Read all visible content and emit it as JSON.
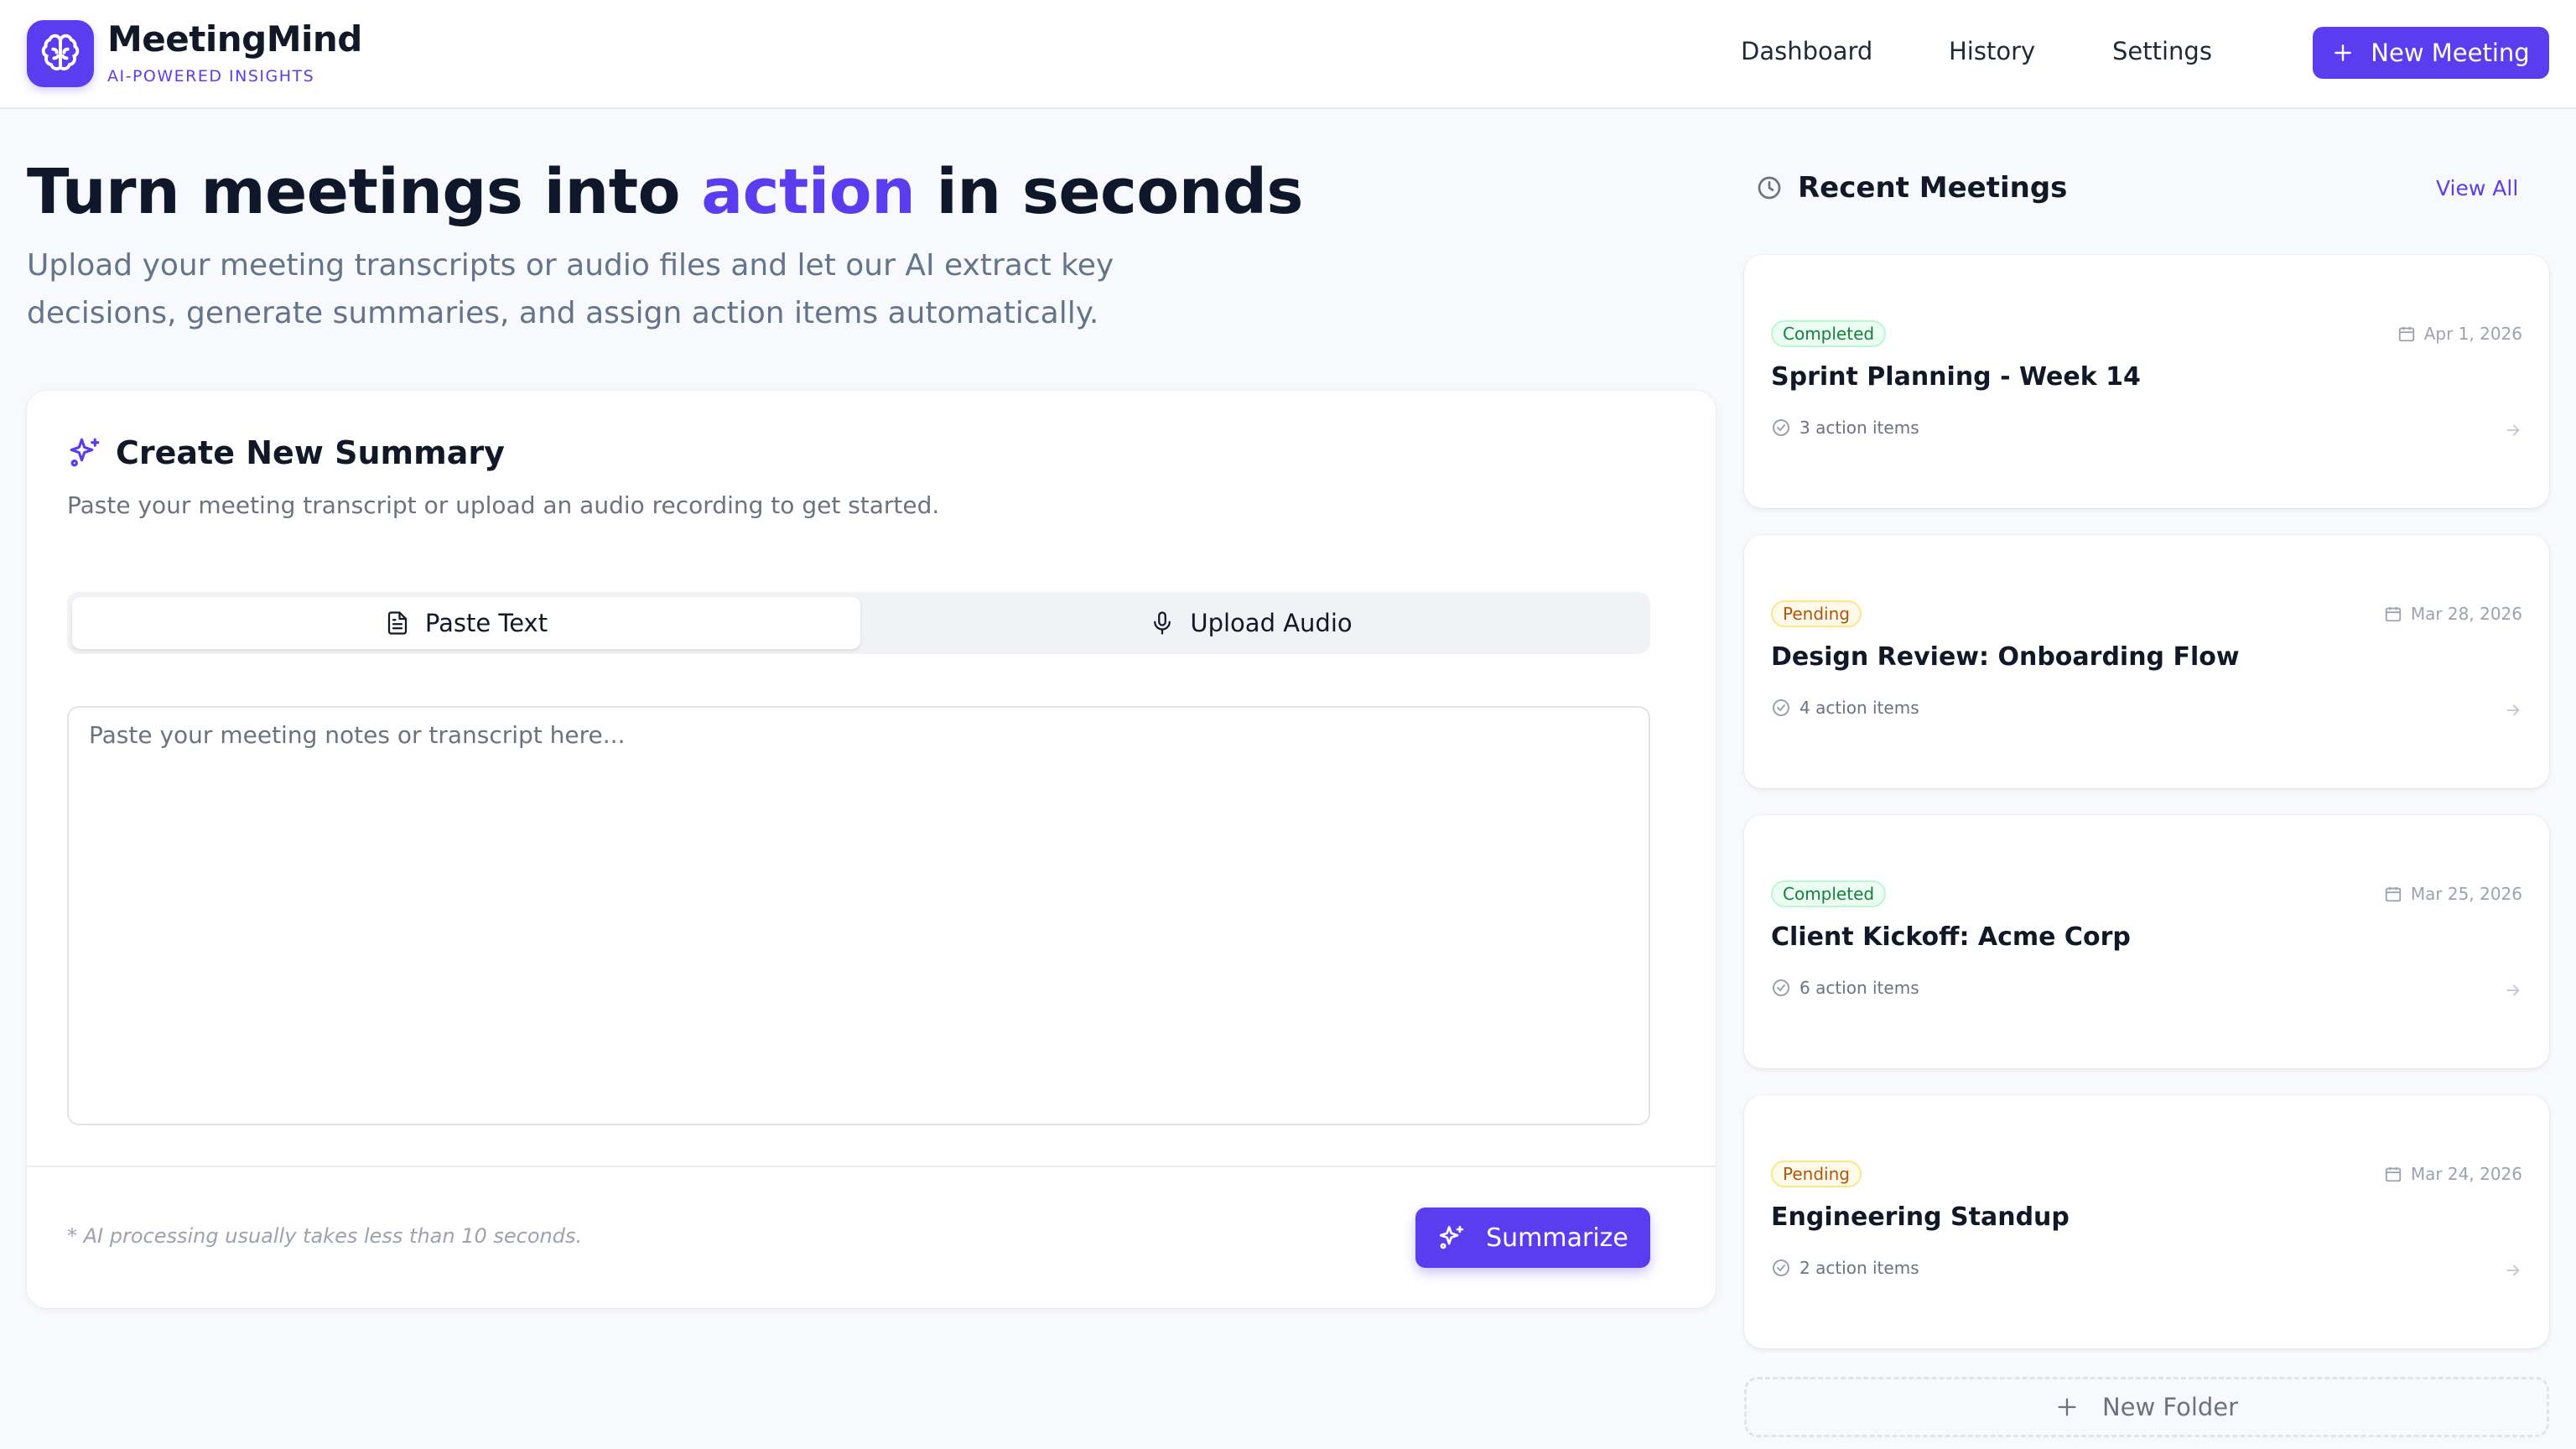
{
  "app": {
    "name": "MeetingMind",
    "tagline": "AI-POWERED INSIGHTS"
  },
  "nav": {
    "items": [
      "Dashboard",
      "History",
      "Settings"
    ],
    "new_meeting_label": "New Meeting"
  },
  "hero": {
    "title_before": "Turn meetings into ",
    "title_accent": "action",
    "title_after": " in seconds",
    "subtitle": "Upload your meeting transcripts or audio files and let our AI extract key decisions, generate summaries, and assign action items automatically."
  },
  "create": {
    "title": "Create New Summary",
    "description": "Paste your meeting transcript or upload an audio recording to get started.",
    "tabs": [
      {
        "label": "Paste Text",
        "icon": "document-icon",
        "active": true
      },
      {
        "label": "Upload Audio",
        "icon": "microphone-icon",
        "active": false
      }
    ],
    "textarea": {
      "value": "",
      "placeholder": "Paste your meeting notes or transcript here..."
    },
    "footnote": "* AI processing usually takes less than 10 seconds.",
    "summarize_label": "Summarize"
  },
  "recent": {
    "title": "Recent Meetings",
    "view_all_label": "View All",
    "meetings": [
      {
        "status": "Completed",
        "date": "Apr 1, 2026",
        "title": "Sprint Planning - Week 14",
        "actions": "3 action items"
      },
      {
        "status": "Pending",
        "date": "Mar 28, 2026",
        "title": "Design Review: Onboarding Flow",
        "actions": "4 action items"
      },
      {
        "status": "Completed",
        "date": "Mar 25, 2026",
        "title": "Client Kickoff: Acme Corp",
        "actions": "6 action items"
      },
      {
        "status": "Pending",
        "date": "Mar 24, 2026",
        "title": "Engineering Standup",
        "actions": "2 action items"
      }
    ],
    "new_folder_label": "New Folder"
  },
  "colors": {
    "accent": "#5b3df0",
    "completed": "#15803d",
    "pending": "#b45309"
  }
}
